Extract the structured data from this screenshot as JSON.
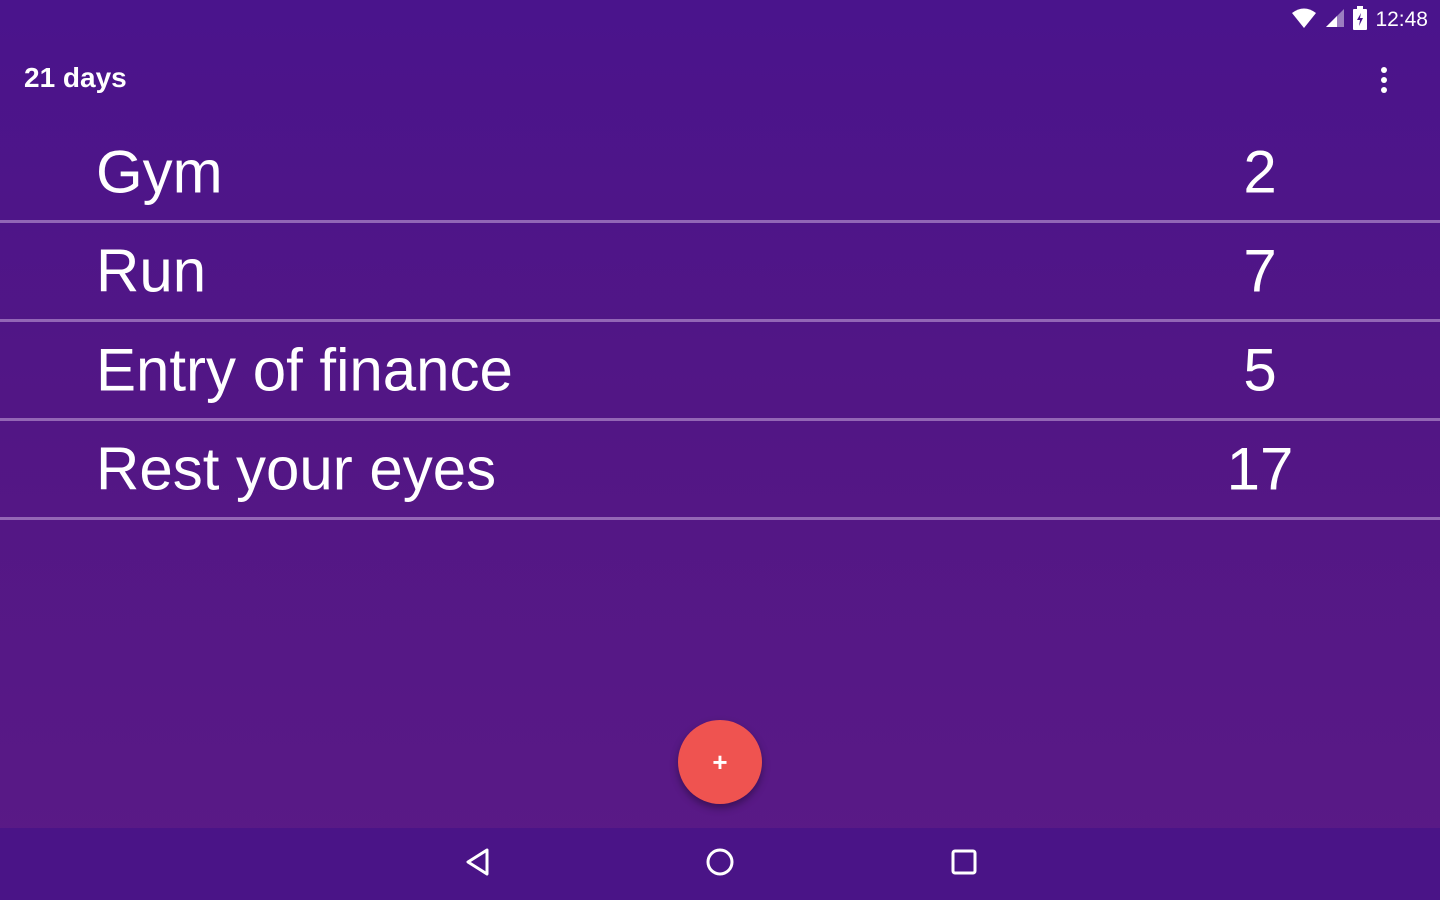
{
  "status_bar": {
    "time": "12:48",
    "icons": [
      "wifi-icon",
      "cellular-signal-icon",
      "battery-icon"
    ]
  },
  "app_bar": {
    "title": "21 days",
    "menu_icon": "overflow-menu-icon"
  },
  "habits": [
    {
      "name": "Gym",
      "count": "2"
    },
    {
      "name": "Run",
      "count": "7"
    },
    {
      "name": "Entry of finance",
      "count": "5"
    },
    {
      "name": "Rest your eyes",
      "count": "17"
    }
  ],
  "fab": {
    "label": "+",
    "color": "#ef5350"
  },
  "nav_bar": {
    "icons": [
      "back-icon",
      "home-icon",
      "recents-icon"
    ]
  },
  "colors": {
    "background": "#4a148c",
    "divider": "#c8aadc",
    "text": "#ffffff"
  }
}
